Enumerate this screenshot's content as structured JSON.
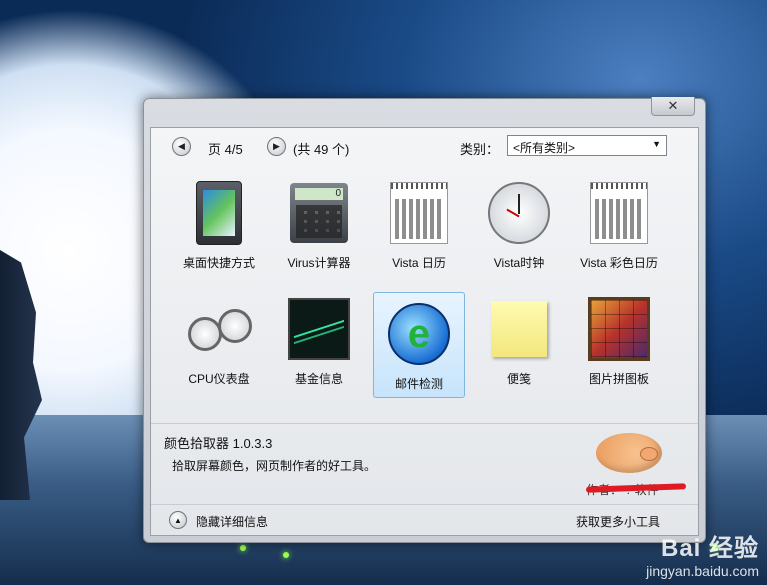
{
  "window": {
    "close_label": "✕",
    "pager": {
      "prev_icon": "◀",
      "next_icon": "▶",
      "page_text": "页 4/5",
      "total_text": "(共 49 个)"
    },
    "category": {
      "label": "类别：",
      "value": "<所有类别>",
      "arrow": "▼"
    },
    "gadgets": [
      {
        "label": "桌面快捷方式",
        "icon": "desktop-shortcut-icon"
      },
      {
        "label": "Virus计算器",
        "icon": "calculator-icon"
      },
      {
        "label": "Vista 日历",
        "icon": "calendar-icon"
      },
      {
        "label": "Vista时钟",
        "icon": "clock-icon"
      },
      {
        "label": "Vista 彩色日历",
        "icon": "color-calendar-icon"
      },
      {
        "label": "CPU仪表盘",
        "icon": "cpu-gauge-icon"
      },
      {
        "label": "基金信息",
        "icon": "stock-chart-icon"
      },
      {
        "label": "邮件检测",
        "icon": "mail-check-icon",
        "selected": true
      },
      {
        "label": "便笺",
        "icon": "sticky-note-icon"
      },
      {
        "label": "图片拼图板",
        "icon": "picture-puzzle-icon"
      }
    ],
    "details": {
      "title": "颜色拾取器 1.0.3.3",
      "description": "拾取屏幕颜色，网页制作者的好工具。",
      "author": "作者：*.*软件"
    },
    "footer": {
      "hide_icon": "▲",
      "hide_label": "隐藏详细信息",
      "more_link": "获取更多小工具"
    }
  },
  "watermark": {
    "logo": "Bai 经验",
    "url": "jingyan.baidu.com"
  }
}
